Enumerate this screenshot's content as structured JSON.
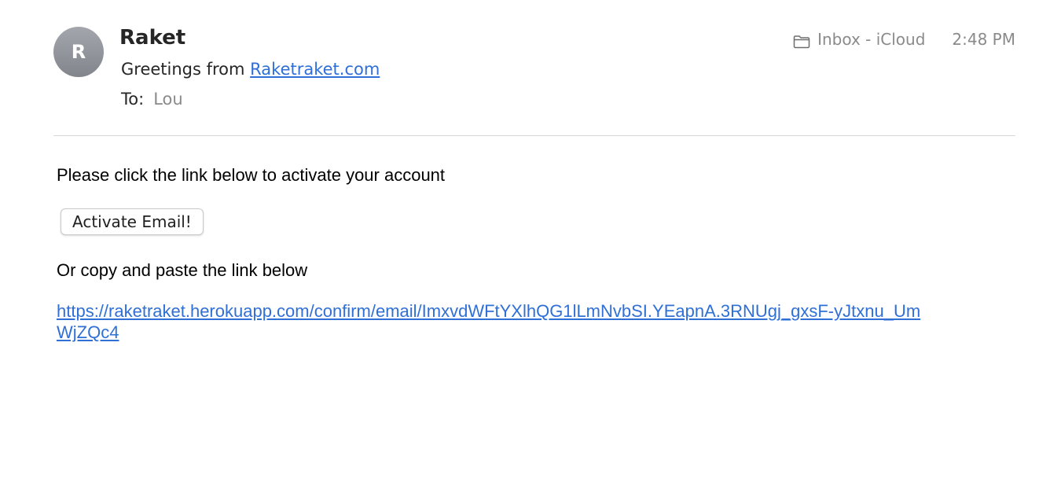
{
  "message": {
    "avatar_initial": "R",
    "sender": "Raket",
    "subject_prefix": "Greetings from ",
    "subject_link": "Raketraket.com",
    "to_label": "To:",
    "to_value": "Lou",
    "mailbox": "Inbox - iCloud",
    "time": "2:48 PM",
    "mailbox_icon": "folder-icon"
  },
  "content": {
    "intro": "Please click the link below to activate your account",
    "activate_button": "Activate Email!",
    "copy_text": "Or copy and paste the link below",
    "activation_url": "https://raketraket.herokuapp.com/confirm/email/ImxvdWFtYXlhQG1lLmNvbSI.YEapnA.3RNUgj_gxsF-yJtxnu_UmWjZQc4"
  },
  "colors": {
    "link": "#2f6fd6",
    "avatar": "#8f9199",
    "muted": "#8a8a8a"
  }
}
